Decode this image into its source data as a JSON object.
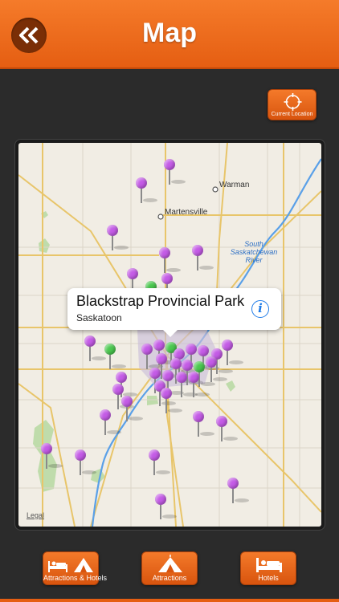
{
  "header": {
    "title": "Map",
    "back_icon": "double-chevron-left-icon"
  },
  "current_location": {
    "label": "Current Location",
    "icon": "crosshair-icon"
  },
  "map": {
    "labels": {
      "warman": "Warman",
      "martensville": "Martensville",
      "river_line1": "South",
      "river_line2": "Saskatchewan",
      "river_line3": "River"
    },
    "legal": "Legal",
    "pin_colors": {
      "attraction": "#c45be6",
      "hotel": "#4bc84f"
    }
  },
  "callout": {
    "title": "Blackstrap Provincial Park",
    "subtitle": "Saskatoon"
  },
  "tabs": [
    {
      "label": "Attractions & Hotels",
      "icon": "bed-tent-icon"
    },
    {
      "label": "Attractions",
      "icon": "tent-icon"
    },
    {
      "label": "Hotels",
      "icon": "bed-icon"
    }
  ],
  "colors": {
    "accent": "#e8651a",
    "background": "#2b2b2b",
    "river": "#5aa0e8",
    "roads": "#e8c56a"
  }
}
